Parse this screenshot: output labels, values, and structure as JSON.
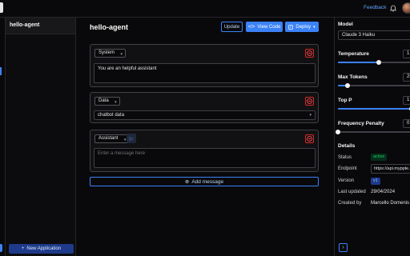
{
  "header": {
    "feedback_label": "Feedback"
  },
  "sidebar": {
    "app_name": "hello-agent",
    "new_app_label": "New Application"
  },
  "main": {
    "title": "hello-agent",
    "buttons": {
      "update": "Update",
      "view_code": "View Code",
      "deploy": "Deploy"
    },
    "messages": [
      {
        "role": "System",
        "content": "You are an helpful assistant"
      },
      {
        "role": "Data",
        "content": "chatbot data"
      },
      {
        "role": "Assistant",
        "placeholder": "Enter a message here"
      }
    ],
    "add_message_label": "Add message"
  },
  "settings": {
    "model_label": "Model",
    "model_value": "Claude 3 Haiku",
    "temperature": {
      "label": "Temperature",
      "value_text": "1",
      "fraction": 0.55
    },
    "max_tokens": {
      "label": "Max Tokens",
      "value_text": "25",
      "fraction": 0.13
    },
    "top_p": {
      "label": "Top P",
      "value_text": "1",
      "fraction": 1.0
    },
    "frequency_penalty": {
      "label": "Frequency Penalty",
      "value_text": "0",
      "fraction": 0.0
    }
  },
  "details": {
    "heading": "Details",
    "status_label": "Status",
    "status_value": "active",
    "endpoint_label": "Endpoint",
    "endpoint_value": "https://api.mypple.io",
    "version_label": "Version",
    "version_value": "v1",
    "last_updated_label": "Last updated",
    "last_updated_value": "29/04/2024",
    "created_by_label": "Created by",
    "created_by_value": "Marcello Domenis"
  },
  "colors": {
    "accent": "#3b82f6",
    "danger": "#ef4444",
    "success": "#22c55e",
    "background": "#09090b"
  },
  "icons": [
    "bell-icon",
    "plus-icon",
    "code-icon",
    "deploy-icon",
    "minus-circle-icon",
    "play-icon",
    "chevron-down-icon",
    "plus-circle-icon",
    "chevron-right-icon"
  ]
}
